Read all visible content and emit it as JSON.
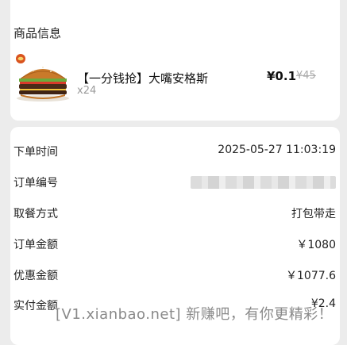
{
  "product_section": {
    "title": "商品信息",
    "item": {
      "name": "【一分钱抢】大嘴安格斯",
      "quantity": "x24",
      "price": "¥0.1",
      "original_price": "¥45"
    }
  },
  "order": {
    "rows": [
      {
        "label": "下单时间",
        "value": "2025-05-27 11:03:19"
      },
      {
        "label": "订单编号",
        "value": ""
      },
      {
        "label": "取餐方式",
        "value": "打包带走"
      },
      {
        "label": "订单金额",
        "value": "￥1080"
      },
      {
        "label": "优惠金额",
        "value": "￥1077.6"
      },
      {
        "label": "实付金额",
        "value": "¥2.4"
      }
    ]
  },
  "watermark": "[V1.xianbao.net] 新赚吧，有你更精彩！"
}
